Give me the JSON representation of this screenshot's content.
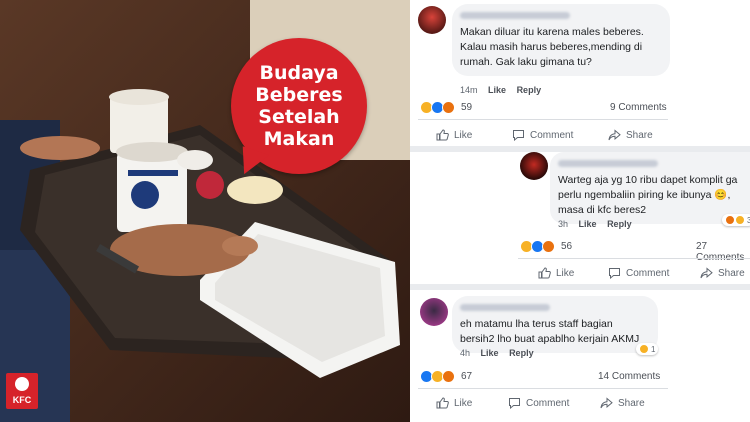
{
  "meme": {
    "title_line1": "Budaya",
    "title_line2": "Beberes",
    "title_line3": "Setelah",
    "title_line4": "Makan",
    "logo_text": "KFC"
  },
  "actions": {
    "like": "Like",
    "comment": "Comment",
    "share": "Share"
  },
  "comments": [
    {
      "text": "Makan diluar itu karena males beberes. Kalau masih harus beberes,mending di rumah. Gak laku gimana tu?",
      "time": "14m",
      "like": "Like",
      "reply": "Reply",
      "reaction_count": "59",
      "comment_count": "9 Comments"
    },
    {
      "text": "Warteg aja yg 10 ribu dapet komplit ga perlu ngembaliin piring ke ibunya 😊, masa di kfc beres2",
      "time": "3h",
      "like": "Like",
      "reply": "Reply",
      "badge_count": "3",
      "reaction_count": "56",
      "comment_count": "27 Comments"
    },
    {
      "text": "eh matamu lha terus staff bagian bersih2 lho buat apablho kerjain AKMJ",
      "time": "4h",
      "like": "Like",
      "reply": "Reply",
      "badge_count": "1",
      "reaction_count": "67",
      "comment_count": "14 Comments"
    }
  ],
  "colors": {
    "bubble_red": "#d6232a",
    "fb_blue": "#1877f2",
    "panel_gray": "#e9ebee"
  }
}
